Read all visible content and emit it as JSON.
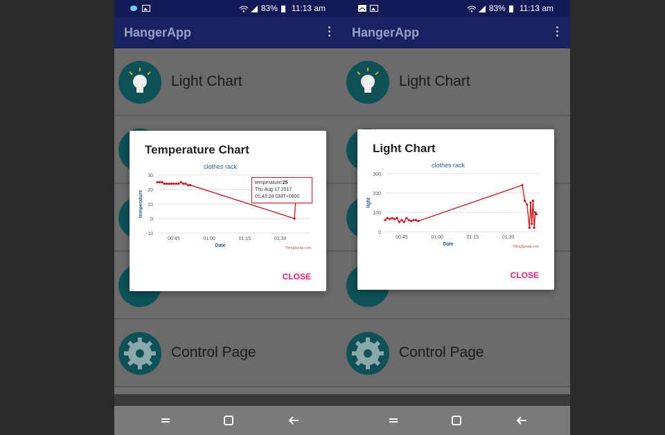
{
  "status": {
    "battery": "83%",
    "time": "11:13 am"
  },
  "app": {
    "title": "HangerApp"
  },
  "list": {
    "light_chart_label": "Light Chart",
    "control_page_label": "Control Page"
  },
  "colors": {
    "accent": "#e8207a",
    "appbar": "#1a2161",
    "series": "#c8141c",
    "icon_bg": "#0e5156"
  },
  "left_dialog": {
    "title": "Temperature Chart",
    "close_label": "CLOSE",
    "tooltip": {
      "field": "temperature",
      "value": "25",
      "date_line": "Thu Aug 17 2017",
      "time_line": "01:43:28 GMT+0800"
    }
  },
  "right_dialog": {
    "title": "Light Chart",
    "close_label": "CLOSE"
  },
  "chart_data": [
    {
      "type": "line",
      "title": "clothes rack",
      "xlabel": "Date",
      "ylabel": "temperature",
      "credit": "ThingSpeak.com",
      "x_tick_labels": [
        "00:45",
        "01:00",
        "01:15",
        "01:30"
      ],
      "x_tick_minutes": [
        45,
        60,
        75,
        90
      ],
      "xlim_minutes": [
        38,
        103
      ],
      "ylim": [
        -10,
        30
      ],
      "yticks": [
        -10,
        0,
        10,
        20,
        30
      ],
      "series": [
        {
          "x_minutes": [
            38,
            39,
            40,
            41,
            42,
            43,
            44,
            45,
            46,
            47,
            48,
            49,
            50,
            51,
            52,
            96,
            97,
            98,
            99,
            100,
            101,
            102
          ],
          "values": [
            25,
            25,
            25,
            24,
            24,
            24,
            24,
            24,
            24,
            24,
            25,
            24,
            24,
            23,
            23,
            0,
            25,
            25,
            24,
            25,
            25,
            25
          ]
        }
      ]
    },
    {
      "type": "line",
      "title": "clothes rack",
      "xlabel": "Date",
      "ylabel": "light",
      "credit": "ThingSpeak.com",
      "x_tick_labels": [
        "00:45",
        "01:00",
        "01:15",
        "01:30"
      ],
      "x_tick_minutes": [
        45,
        60,
        75,
        90
      ],
      "xlim_minutes": [
        38,
        103
      ],
      "ylim": [
        0,
        300
      ],
      "yticks": [
        0,
        100,
        200,
        300
      ],
      "series": [
        {
          "x_minutes": [
            38,
            39,
            40,
            41,
            42,
            43,
            44,
            45,
            46,
            47,
            48,
            49,
            50,
            51,
            52,
            96,
            97,
            98,
            99,
            99.5,
            100,
            100.5,
            101,
            101.5,
            102
          ],
          "values": [
            60,
            70,
            65,
            70,
            65,
            70,
            50,
            60,
            50,
            70,
            60,
            55,
            60,
            60,
            55,
            240,
            160,
            140,
            20,
            150,
            40,
            160,
            20,
            100,
            90
          ]
        }
      ]
    }
  ]
}
